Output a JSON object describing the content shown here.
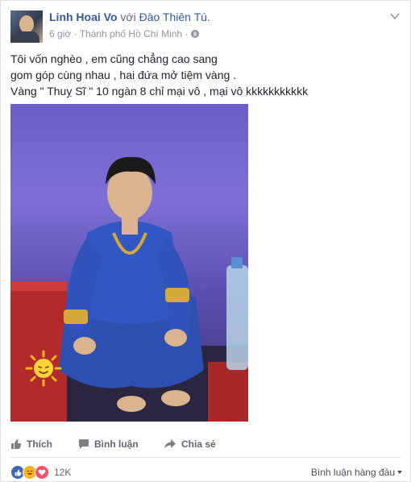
{
  "post": {
    "author": "Linh Hoai Vo",
    "with_word": "với",
    "tagged": "Đào Thiên Tú.",
    "time": "6 giờ",
    "separator": "·",
    "location": "Thành phố Hồ Chí Minh",
    "separator2": "·",
    "privacy_icon": "globe-icon",
    "text_lines": [
      "Tôi vốn nghèo , em cũng chẳng cao sang",
      "gom góp cùng nhau , hai đứa mở tiệm vàng .",
      "Vàng \" Thuỵ Sĩ \" 10 ngàn 8 chỉ mại vô , mại vô kkkkkkkkkkk"
    ]
  },
  "actions": {
    "like": "Thích",
    "comment": "Bình luận",
    "share": "Chia sẻ"
  },
  "reactions": {
    "count": "12K",
    "types": [
      "like-icon",
      "haha-icon",
      "love-icon"
    ]
  },
  "sort": {
    "label": "Bình luận hàng đầu"
  },
  "colors": {
    "link": "#365899",
    "meta": "#90949c",
    "text": "#1d2129",
    "like": "#4267b2",
    "haha": "#f7b125",
    "love": "#f25268"
  }
}
